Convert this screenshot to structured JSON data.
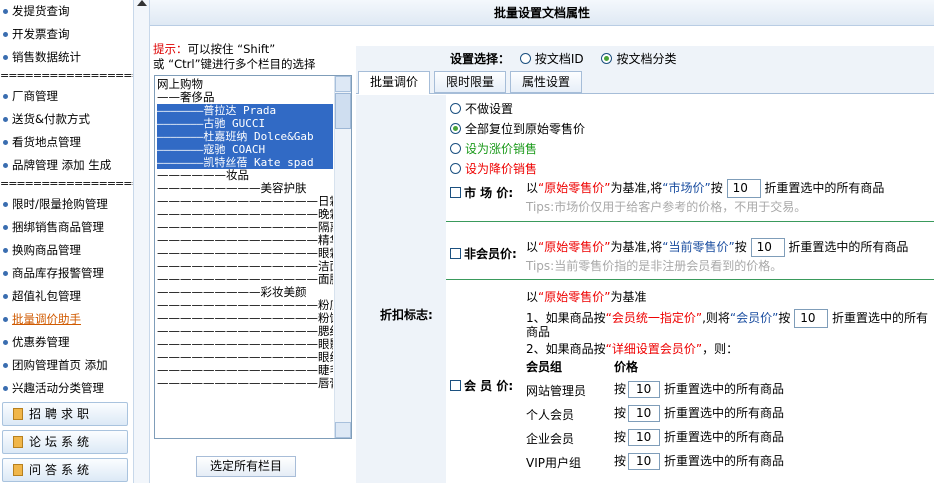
{
  "sidebar": {
    "items_top": [
      "发提货查询",
      "开发票查询",
      "销售数据统计"
    ],
    "sep1": "==================",
    "items_mid1": [
      "厂商管理",
      "送货&付款方式",
      "看货地点管理",
      "品牌管理 添加 生成"
    ],
    "sep2": "==================",
    "items_mid2": [
      "限时/限量抢购管理",
      "捆绑销售商品管理",
      "换购商品管理",
      "商品库存报警管理",
      "超值礼包管理",
      "批量调价助手",
      "优惠券管理",
      "团购管理首页 添加",
      "兴趣活动分类管理"
    ],
    "big_buttons": [
      "招聘求职",
      "论坛系统",
      "问答系统"
    ]
  },
  "page_title": "批量设置文档属性",
  "tip": {
    "label": "提示：",
    "line1": "可以按住 “Shift”",
    "line2": "或 “Ctrl”键进行多个栏目的选择"
  },
  "categories": [
    "网上购物",
    "——奢侈品",
    "———————普拉达 Prada",
    "———————古驰 GUCCI",
    "———————杜嘉班纳 Dolce&Gab",
    "———————寇驰 COACH",
    "———————凯特丝蓓 Kate spad",
    "——————妆品",
    "—————————美容护肤",
    "——————————————日霜",
    "——————————————晚霜",
    "——————————————隔离霜",
    "——————————————精华素",
    "——————————————眼霜",
    "——————————————洁面乳",
    "——————————————面膜",
    "—————————彩妆美颜",
    "——————————————粉底",
    "——————————————粉饼",
    "——————————————腮红颊彩",
    "——————————————眼影",
    "——————————————眼线",
    "——————————————睫毛膏液",
    "——————————————唇膏"
  ],
  "select_all_button": "选定所有栏目",
  "settings": {
    "label": "设置选择：",
    "opt_id": "按文档ID",
    "opt_cat": "按文档分类"
  },
  "tabs": [
    "批量调价",
    "限时限量",
    "属性设置"
  ],
  "flag_label": "折扣标志:",
  "modes": {
    "none": "不做设置",
    "reset": "全部复位到原始零售价",
    "up": "设为涨价销售",
    "down": "设为降价销售"
  },
  "market": {
    "label": "市 场 价:",
    "t1": "以",
    "base": "“原始零售价”",
    "t2": "为基准,将",
    "target": "“市场价”",
    "t3": "按",
    "value": "10",
    "t4": "折重置选中的所有商品",
    "tip": "Tips:市场价仅用于给客户参考的价格，不用于交易。"
  },
  "nonmember": {
    "label": "非会员价:",
    "t1": "以",
    "base": "“原始零售价”",
    "t2": "为基准,将",
    "target": "“当前零售价”",
    "t3": "按",
    "value": "10",
    "t4": "折重置选中的所有商品",
    "tip": "Tips:当前零售价指的是非注册会员看到的价格。"
  },
  "member": {
    "label": "会 员 价:",
    "l0a": "以",
    "l0b": "“原始零售价”",
    "l0c": "为基准",
    "l1a": "1、如果商品按",
    "l1b": "“会员统一指定价”",
    "l1c": ",则将",
    "l1d": "“会员价”",
    "l1e": "按",
    "l1value": "10",
    "l1f": "折重置选中的所有",
    "l1g": "商品",
    "l2a": "2、如果商品按",
    "l2b": "“详细设置会员价”",
    "l2c": "，则：",
    "col_group": "会员组",
    "col_price": "价格",
    "groups": [
      {
        "name": "网站管理员",
        "by": "按",
        "value": "10",
        "tail": "折重置选中的所有商品"
      },
      {
        "name": "个人会员",
        "by": "按",
        "value": "10",
        "tail": "折重置选中的所有商品"
      },
      {
        "name": "企业会员",
        "by": "按",
        "value": "10",
        "tail": "折重置选中的所有商品"
      },
      {
        "name": "VIP用户组",
        "by": "按",
        "value": "10",
        "tail": "折重置选中的所有商品"
      }
    ]
  }
}
